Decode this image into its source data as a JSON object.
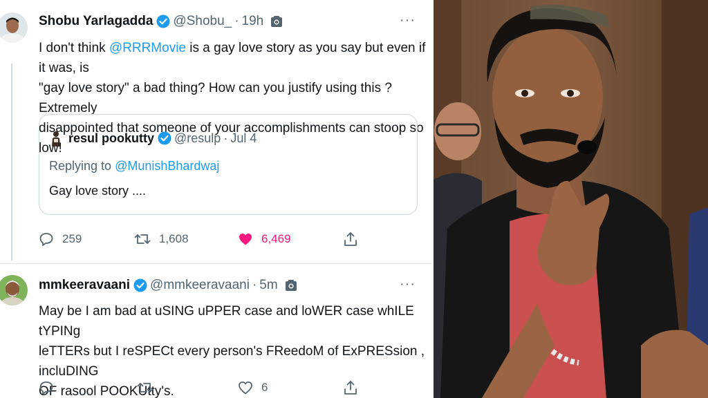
{
  "tweet1": {
    "name": "Shobu Yarlagadda",
    "handle": "@Shobu_",
    "dot": "·",
    "time": "19h",
    "text_a": "I don't think ",
    "mention": "@RRRMovie",
    "text_b": " is a gay love story as you say but even if it was, is",
    "line2": "\"gay love story\" a bad thing? How can you justify using this ?  Extremely",
    "line3": "disappointed that someone of your accomplishments can stoop so low!",
    "quote": {
      "name": "resul pookutty",
      "handle": "@resulp",
      "dot": "·",
      "date": "Jul 4",
      "replying_prefix": "Replying to ",
      "replying_to": "@MunishBhardwaj",
      "text": "Gay love story ...."
    },
    "actions": {
      "replies": "259",
      "retweets": "1,608",
      "likes": "6,469"
    }
  },
  "tweet2": {
    "name": "mmkeeravaani",
    "handle": "@mmkeeravaani",
    "dot": "·",
    "time": "5m",
    "line1": "May be I am bad at uSING uPPER case and loWER case whILE tYPINg",
    "line2": "leTTERs but I reSPECt every person's FReedoM of ExPRESsion , incluDING",
    "line3": "OF rasool POOKUtty's.",
    "actions": {
      "replies": "",
      "retweets": "",
      "likes": "6"
    }
  },
  "icons": {
    "verified": "verified-badge-icon",
    "camera": "camera-icon",
    "more": "more-horizontal-icon",
    "reply": "reply-icon",
    "retweet": "retweet-icon",
    "like": "heart-icon",
    "share": "share-icon"
  },
  "colors": {
    "accent": "#1d9bf0",
    "like": "#f91880",
    "muted": "#536471",
    "text": "#0f1419"
  }
}
